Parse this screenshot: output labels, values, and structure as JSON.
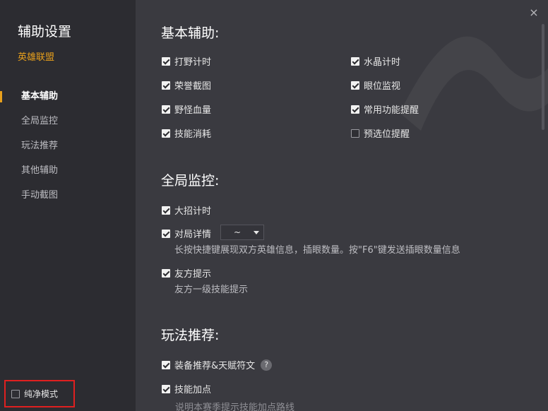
{
  "sidebar": {
    "title": "辅助设置",
    "game": "英雄联盟",
    "nav": [
      "基本辅助",
      "全局监控",
      "玩法推荐",
      "其他辅助",
      "手动截图"
    ],
    "active": "基本辅助",
    "clean_mode": {
      "label": "纯净模式",
      "checked": false
    }
  },
  "window": {
    "close_icon": "×"
  },
  "basic": {
    "title": "基本辅助:",
    "options": [
      {
        "label": "打野计时",
        "checked": true
      },
      {
        "label": "水晶计时",
        "checked": true
      },
      {
        "label": "荣誉截图",
        "checked": true
      },
      {
        "label": "眼位监视",
        "checked": true
      },
      {
        "label": "野怪血量",
        "checked": true
      },
      {
        "label": "常用功能提醒",
        "checked": true
      },
      {
        "label": "技能消耗",
        "checked": true
      },
      {
        "label": "预选位提醒",
        "checked": false
      }
    ]
  },
  "global": {
    "title": "全局监控:",
    "ult_timer": {
      "label": "大招计时",
      "checked": true
    },
    "match_detail": {
      "label": "对局详情",
      "checked": true,
      "select_value": "~",
      "desc": "长按快捷键展现双方英雄信息，插眼数量。按\"F6\"键发送插眼数量信息"
    },
    "ally_hint": {
      "label": "友方提示",
      "checked": true,
      "desc": "友方一级技能提示"
    }
  },
  "recommend": {
    "title": "玩法推荐:",
    "equip": {
      "label": "装备推荐&天赋符文",
      "checked": true,
      "help": "?"
    },
    "skill": {
      "label": "技能加点",
      "checked": true,
      "desc_cut": "说明本赛季提示技能加点路线"
    }
  },
  "colors": {
    "accent": "#e8a01c",
    "highlight_box": "#e02020",
    "bg": "#3a3a40",
    "sidebar": "#2c2c31"
  }
}
